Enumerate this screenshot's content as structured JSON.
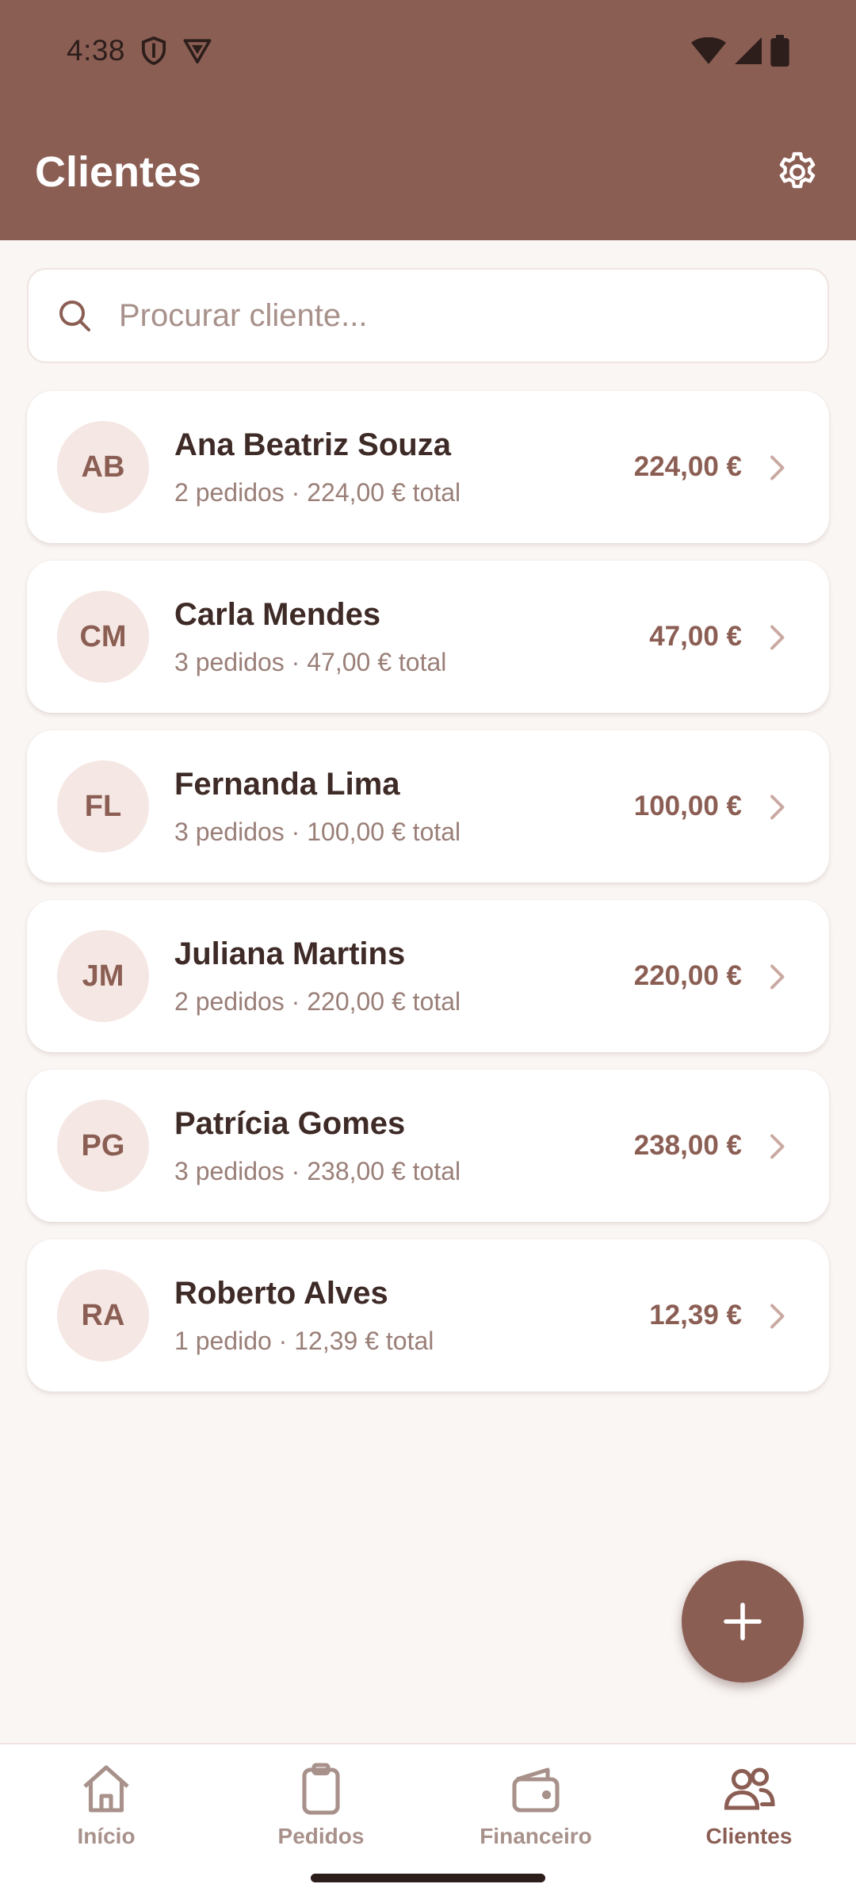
{
  "status_bar": {
    "time": "4:38"
  },
  "header": {
    "title": "Clientes"
  },
  "search": {
    "placeholder": "Procurar cliente..."
  },
  "clients": [
    {
      "initials": "AB",
      "name": "Ana Beatriz Souza",
      "summary": "2 pedidos · 224,00 € total",
      "amount": "224,00 €"
    },
    {
      "initials": "CM",
      "name": "Carla Mendes",
      "summary": "3 pedidos · 47,00 € total",
      "amount": "47,00 €"
    },
    {
      "initials": "FL",
      "name": "Fernanda Lima",
      "summary": "3 pedidos · 100,00 € total",
      "amount": "100,00 €"
    },
    {
      "initials": "JM",
      "name": "Juliana Martins",
      "summary": "2 pedidos · 220,00 € total",
      "amount": "220,00 €"
    },
    {
      "initials": "PG",
      "name": "Patrícia Gomes",
      "summary": "3 pedidos · 238,00 € total",
      "amount": "238,00 €"
    },
    {
      "initials": "RA",
      "name": "Roberto Alves",
      "summary": "1 pedido · 12,39 € total",
      "amount": "12,39 €"
    }
  ],
  "nav": [
    {
      "label": "Início",
      "icon": "home-icon"
    },
    {
      "label": "Pedidos",
      "icon": "clipboard-icon"
    },
    {
      "label": "Financeiro",
      "icon": "wallet-icon"
    },
    {
      "label": "Clientes",
      "icon": "users-icon",
      "active": true
    }
  ],
  "colors": {
    "primary": "#8b5e54",
    "background": "#faf6f4",
    "avatar_bg": "#f5e7e3",
    "muted": "#a8918b"
  }
}
